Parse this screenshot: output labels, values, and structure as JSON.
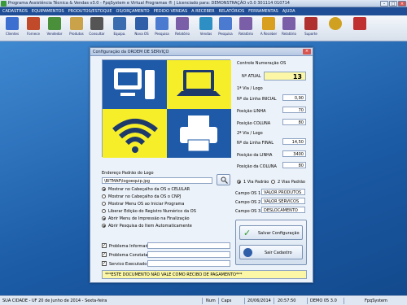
{
  "window": {
    "title": "Programa Assistência Técnica & Vendas v3.0 - FpqSystem e Virtual Programas ® | Licenciado para: DEMONSTRAÇÃO v3.0 301114 010714"
  },
  "menu": [
    "CADASTROS",
    "EQUIPAMENTOS",
    "PRODUTOS/ESTOQUE",
    "OS/ORÇAMENTO",
    "PEDIDO VENDAS",
    "A RECEBER",
    "RELATÓRIOS",
    "FERRAMENTAS",
    "AJUDA"
  ],
  "toolbar": [
    {
      "label": "Clientes",
      "icon": "clients-icon",
      "color": "#3d6fd1"
    },
    {
      "label": "Fornece",
      "icon": "supplier-icon",
      "color": "#c04a2a"
    },
    {
      "label": "Vendedor",
      "icon": "seller-icon",
      "color": "#4a8f3a"
    },
    {
      "label": "Produtos",
      "icon": "products-icon",
      "color": "#c9a24a"
    },
    {
      "label": "Consultar",
      "icon": "search-products-icon",
      "color": "#555555"
    },
    {
      "label": "Equipa.",
      "icon": "equipment-icon",
      "color": "#3a6db0"
    },
    {
      "label": "Nova OS",
      "icon": "new-os-icon",
      "color": "#2f5fa8"
    },
    {
      "label": "Pesquisa",
      "icon": "search-os-icon",
      "color": "#4b7bd0"
    },
    {
      "label": "Relatório",
      "icon": "report-icon",
      "color": "#7a5fa8"
    },
    {
      "label": "Vendas",
      "icon": "sales-icon",
      "color": "#2e8fc4"
    },
    {
      "label": "Pesquisa",
      "icon": "search-sales-icon",
      "color": "#4b7bd0"
    },
    {
      "label": "Relatório",
      "icon": "report-sales-icon",
      "color": "#7a5fa8"
    },
    {
      "label": "A Receber",
      "icon": "receivable-icon",
      "color": "#d9a020"
    },
    {
      "label": "Relatório",
      "icon": "report-receivable-icon",
      "color": "#7a5fa8"
    },
    {
      "label": "Suporte",
      "icon": "support-icon",
      "color": "#b03030"
    },
    {
      "label": "",
      "icon": "money-icon",
      "color": "#d0a020"
    },
    {
      "label": "",
      "icon": "exit-icon",
      "color": "#c03030"
    }
  ],
  "dialog": {
    "title": "Configuração da ORDEM DE SERVIÇO",
    "controle_title": "Controle Numeração OS",
    "n_atual_label": "Nº ATUAL",
    "n_atual_value": "13",
    "via1_title": "1ª Via / Logo",
    "via1_fields": [
      {
        "label": "Nº da Linha INICIAL",
        "value": "0,90"
      },
      {
        "label": "Posição LINHA",
        "value": "70"
      },
      {
        "label": "Posição COLUNA",
        "value": "80"
      }
    ],
    "via2_title": "2ª Via / Logo",
    "via2_fields": [
      {
        "label": "Nº da Linha FINAL",
        "value": "14,50"
      },
      {
        "label": "Posição da LINHA",
        "value": "3400"
      },
      {
        "label": "Posição da COLUNA",
        "value": "80"
      }
    ],
    "logo_path_label": "Endereço Padrão do Logo",
    "logo_path_value": "\\BITMAP\\logoequip.jpg",
    "via_options": [
      "1 Via Padrão",
      "2 Vias Padrão"
    ],
    "options": [
      {
        "label": "Mostrar no Cabeçalho da OS o CELULAR",
        "checked": true
      },
      {
        "label": "Mostrar no Cabeçalho da OS o CNPJ",
        "checked": false
      },
      {
        "label": "Mostrar Menu OS ao Iniciar Programa",
        "checked": false
      },
      {
        "label": "Liberar Edição do Registro Numérico da OS",
        "checked": false
      },
      {
        "label": "Abrir Menu de Impressão na Finalização",
        "checked": true
      },
      {
        "label": "Abrir Pesquisa do Item Automaticamente",
        "checked": true
      }
    ],
    "campos": [
      {
        "label": "Campo OS 1",
        "value": "VALOR PRODUTOS"
      },
      {
        "label": "Campo OS 2",
        "value": "VALOR SERVICOS"
      },
      {
        "label": "Campo OS 3",
        "value": "DESLOCAMENTO"
      }
    ],
    "checks": [
      {
        "label": "Problema Informado:"
      },
      {
        "label": "Problema Constatado:"
      },
      {
        "label": "Servico Executado:"
      }
    ],
    "footer_note": "***ESTE DOCUMENTO NÃO VALE COMO RECIBO DE PAGAMENTO***",
    "save_label": "Salvar Configuração",
    "exit_label": "Sair Cadastro"
  },
  "status": {
    "city": "SUA CIDADE - UF 20 de Junho de 2014 - Sexta-feira",
    "num": "Num",
    "caps": "Caps",
    "date": "20/06/2014",
    "time": "20:57:50",
    "user": "DEMO 05 3.0",
    "brand": "FpqSystem"
  },
  "colors": {
    "accent": "#1f4e96",
    "note_yellow": "#fbf7a6",
    "quadrant_blue": "#1e5aa8",
    "quadrant_yellow": "#f7ee2a"
  }
}
